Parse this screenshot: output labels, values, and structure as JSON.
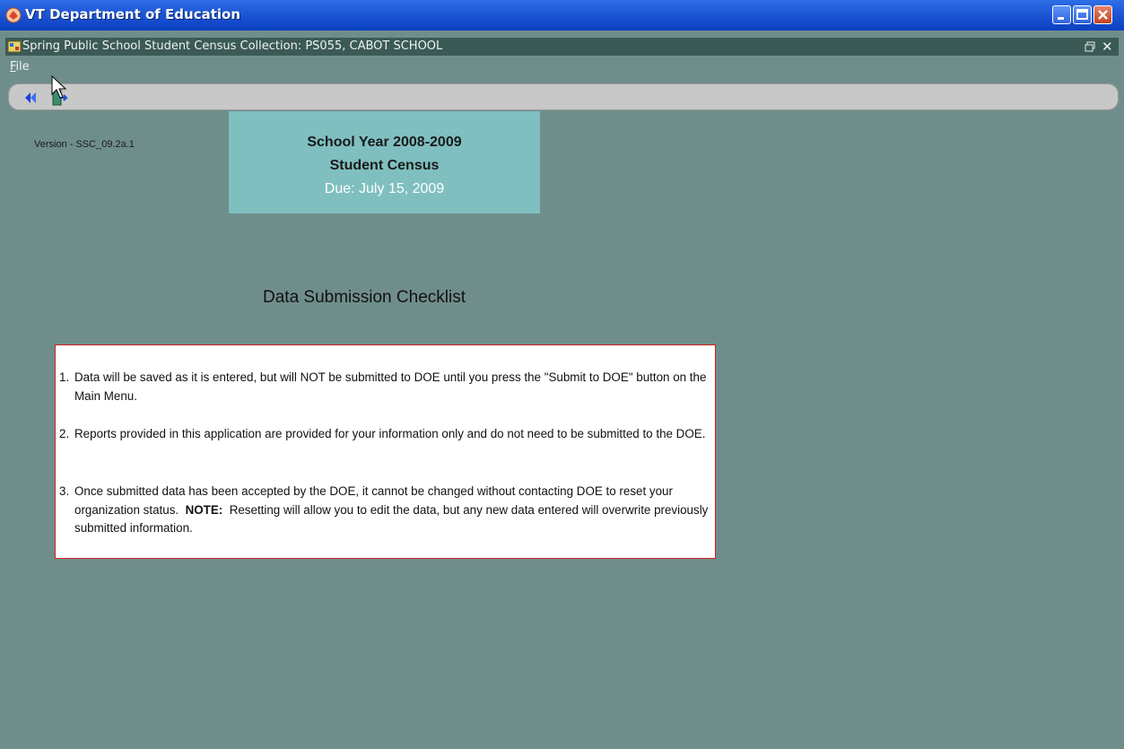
{
  "window": {
    "title": "VT Department of Education"
  },
  "inner_window": {
    "title": "Spring Public School Student Census Collection: PS055, CABOT SCHOOL"
  },
  "menu": {
    "file_label": "File"
  },
  "toolbar": {
    "back_icon": "back-double-arrow-icon",
    "exit_icon": "exit-door-icon"
  },
  "version": "Version - SSC_09.2a.1",
  "header": {
    "line1": "School Year 2008-2009",
    "line2": "Student Census",
    "line3": "Due:  July 15, 2009"
  },
  "checklist": {
    "title": "Data Submission Checklist",
    "items": [
      {
        "num": "1.",
        "text": "Data will be saved as it is entered, but will NOT be submitted to DOE until you press the \"Submit to DOE\" button on the Main Menu."
      },
      {
        "num": "2.",
        "text": "Reports provided in this application are provided for your information only and do not need to be submitted to the DOE."
      },
      {
        "num": "3.",
        "text_before": "Once submitted data has been accepted by the DOE, it cannot be changed without contacting DOE to reset your organization status.",
        "note_label": "NOTE:",
        "text_after": "Resetting will allow you to edit the data, but any new data entered will overwrite previously submitted information."
      }
    ]
  },
  "colors": {
    "background": "#6f8e8b",
    "header_box": "#7fbfbf",
    "checklist_border": "#d21f1f",
    "titlebar": "#1f58d6"
  }
}
